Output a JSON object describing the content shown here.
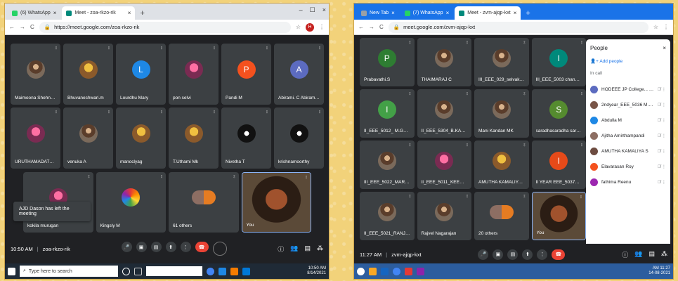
{
  "left": {
    "tabs": [
      {
        "label": "(6) WhatsApp",
        "favicon": "#25d366"
      },
      {
        "label": "Meet - zoa-rkzo-rik",
        "favicon": "#00897b"
      }
    ],
    "url": "https://meet.google.com/zoa-rkzo-rik",
    "profile_initial": "H",
    "tiles": [
      {
        "name": "Maimoona Shehnaaz",
        "kind": "photo"
      },
      {
        "name": "Bhuvaneshwari.m",
        "kind": "photo2"
      },
      {
        "name": "Lourdhu Mary",
        "kind": "letter",
        "letter": "L",
        "color": "#1e88e5"
      },
      {
        "name": "pon selvi",
        "kind": "photo3"
      },
      {
        "name": "Pandi M",
        "kind": "letter",
        "letter": "P",
        "color": "#f4511e"
      },
      {
        "name": "Abirami. C Abirami. C",
        "kind": "letter",
        "letter": "A",
        "color": "#5c6bc0"
      },
      {
        "name": "URUTHAMADATHI. S",
        "kind": "photo3"
      },
      {
        "name": "venuka A",
        "kind": "photo"
      },
      {
        "name": "manoclyag",
        "kind": "photo2"
      },
      {
        "name": "T.Uthami Mk",
        "kind": "photo2"
      },
      {
        "name": "Nivetha T",
        "kind": "photo4"
      },
      {
        "name": "krishnamoorthy",
        "kind": "photo4"
      }
    ],
    "row3": [
      {
        "name": "kokila murugan",
        "kind": "photo3"
      },
      {
        "name": "Kingsly M",
        "kind": "photo5"
      },
      {
        "name": "61 others",
        "kind": "group"
      },
      {
        "name": "You",
        "kind": "self"
      }
    ],
    "toast": "AJD Dason has left the meeting",
    "time": "10:50 AM",
    "code": "zoa-rkzo-rik",
    "taskbar_search": "Type here to search",
    "clock_time": "10:50 AM",
    "clock_date": "8/14/2021"
  },
  "right": {
    "tabs": [
      {
        "label": "New Tab",
        "favicon": "#9aa0a6"
      },
      {
        "label": "(7) WhatsApp",
        "favicon": "#25d366"
      },
      {
        "label": "Meet - zvm-ajqp-kxt",
        "favicon": "#00897b"
      }
    ],
    "url": "meet.google.com/zvm-ajqp-kxt",
    "tiles": [
      {
        "name": "Prabavathi.S",
        "kind": "letter",
        "letter": "P",
        "color": "#2e7d32"
      },
      {
        "name": "THAIMARAJ C",
        "kind": "photo"
      },
      {
        "name": "III_EEE_029_selvakumar...",
        "kind": "photo"
      },
      {
        "name": "III_EEE_5003 chandraleka",
        "kind": "letter",
        "letter": "I",
        "color": "#00897b"
      },
      {
        "name": "II_EEE_5012_ M.Gowsalya",
        "kind": "letter",
        "letter": "I",
        "color": "#43a047"
      },
      {
        "name": "II_EEE_5304_B.KARTHIK...",
        "kind": "photo"
      },
      {
        "name": "Mani Kandan MK",
        "kind": "photo"
      },
      {
        "name": "saradhasaradha saradhasara...",
        "kind": "letter",
        "letter": "S",
        "color": "#558b2f"
      },
      {
        "name": "III_EEE_5022_MARISELVI",
        "kind": "photo"
      },
      {
        "name": "II_EEE_5011_KEERTHANA",
        "kind": "photo3"
      },
      {
        "name": "AMUTHA KAMALIYA S",
        "kind": "photo2"
      },
      {
        "name": "II YEAR EEE_5037_subitha J",
        "kind": "letter",
        "letter": "I",
        "color": "#e64a19"
      },
      {
        "name": "II_EEE_5021_RANJITH",
        "kind": "photo"
      },
      {
        "name": "Rajvel Nagarajan",
        "kind": "photo"
      },
      {
        "name": "20 others",
        "kind": "group"
      },
      {
        "name": "You",
        "kind": "self"
      }
    ],
    "panel": {
      "title": "People",
      "close": "×",
      "add": "Add people",
      "section": "In call",
      "people": [
        {
          "name": "HODEEE JP College... (You)",
          "color": "#5c6bc0"
        },
        {
          "name": "2ndyear_EEE_5036 M.Subi...",
          "color": "#795548"
        },
        {
          "name": "Abdulla M",
          "color": "#1e88e5"
        },
        {
          "name": "Ajitha Amirthampandi",
          "color": "#8d6e63"
        },
        {
          "name": "AMUTHA KAMALIYA S",
          "color": "#6d4c41"
        },
        {
          "name": "Elavarasan Roy",
          "color": "#f4511e"
        },
        {
          "name": "fathima Reenu",
          "color": "#9c27b0"
        }
      ]
    },
    "time": "11:27 AM",
    "code": "zvm-ajqp-kxt",
    "clock_time": "AM 11:27",
    "clock_date": "14-08-2021"
  }
}
